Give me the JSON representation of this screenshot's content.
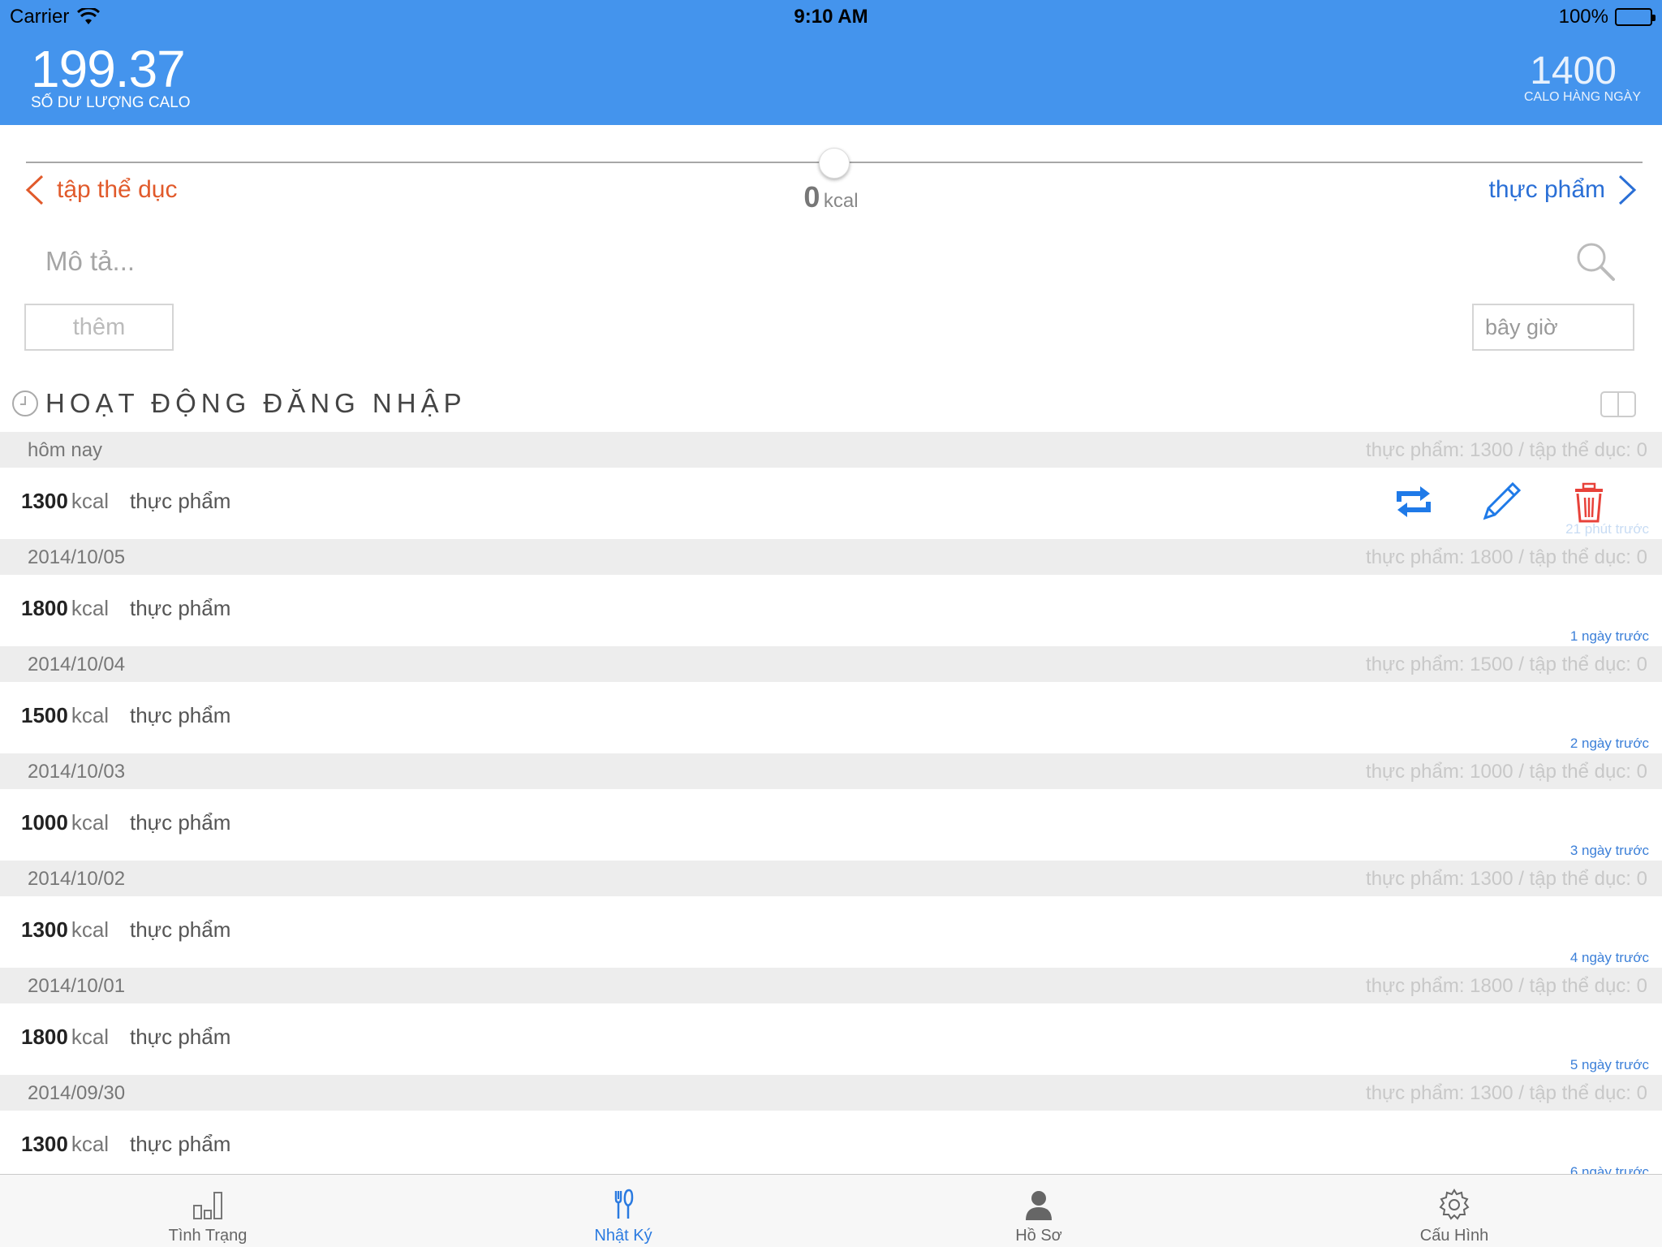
{
  "status_bar": {
    "carrier": "Carrier",
    "time": "9:10 AM",
    "battery": "100%"
  },
  "header": {
    "balance_value": "199.37",
    "balance_label": "SỐ DƯ LƯỢNG CALO",
    "daily_value": "1400",
    "daily_label": "CALO HÀNG NGÀY"
  },
  "slider": {
    "left_label": "tập thể dục",
    "right_label": "thực phẩm",
    "value": "0",
    "unit": "kcal",
    "level_fraction": 0.5
  },
  "entry": {
    "description_placeholder": "Mô tả...",
    "add_label": "thêm",
    "time_value": "bây giờ"
  },
  "activity": {
    "title": "HOẠT ĐỘNG ĐĂNG NHẬP",
    "days": [
      {
        "date": "hôm nay",
        "summary": "thực phẩm: 1300 / tập thể dục: 0",
        "kcal": "1300",
        "unit": "kcal",
        "type": "thực phẩm",
        "ago": "21 phút trước",
        "show_actions": true
      },
      {
        "date": "2014/10/05",
        "summary": "thực phẩm: 1800 / tập thể dục: 0",
        "kcal": "1800",
        "unit": "kcal",
        "type": "thực phẩm",
        "ago": "1 ngày trước",
        "show_actions": false
      },
      {
        "date": "2014/10/04",
        "summary": "thực phẩm: 1500 / tập thể dục: 0",
        "kcal": "1500",
        "unit": "kcal",
        "type": "thực phẩm",
        "ago": "2 ngày trước",
        "show_actions": false
      },
      {
        "date": "2014/10/03",
        "summary": "thực phẩm: 1000 / tập thể dục: 0",
        "kcal": "1000",
        "unit": "kcal",
        "type": "thực phẩm",
        "ago": "3 ngày trước",
        "show_actions": false
      },
      {
        "date": "2014/10/02",
        "summary": "thực phẩm: 1300 / tập thể dục: 0",
        "kcal": "1300",
        "unit": "kcal",
        "type": "thực phẩm",
        "ago": "4 ngày trước",
        "show_actions": false
      },
      {
        "date": "2014/10/01",
        "summary": "thực phẩm: 1800 / tập thể dục: 0",
        "kcal": "1800",
        "unit": "kcal",
        "type": "thực phẩm",
        "ago": "5 ngày trước",
        "show_actions": false
      },
      {
        "date": "2014/09/30",
        "summary": "thực phẩm: 1300 / tập thể dục: 0",
        "kcal": "1300",
        "unit": "kcal",
        "type": "thực phẩm",
        "ago": "6 ngày trước",
        "show_actions": false
      }
    ]
  },
  "tabs": [
    {
      "label": "Tình Trạng",
      "icon": "bar-chart-icon",
      "active": false
    },
    {
      "label": "Nhật Ký",
      "icon": "fork-knife-icon",
      "active": true
    },
    {
      "label": "Hồ Sơ",
      "icon": "person-icon",
      "active": false
    },
    {
      "label": "Cấu Hình",
      "icon": "gear-icon",
      "active": false
    }
  ],
  "colors": {
    "header_bg": "#4494ed",
    "exercise": "#e15a2b",
    "food": "#2a6fd6",
    "delete": "#e8423a",
    "active_tab": "#2a7ae0"
  }
}
